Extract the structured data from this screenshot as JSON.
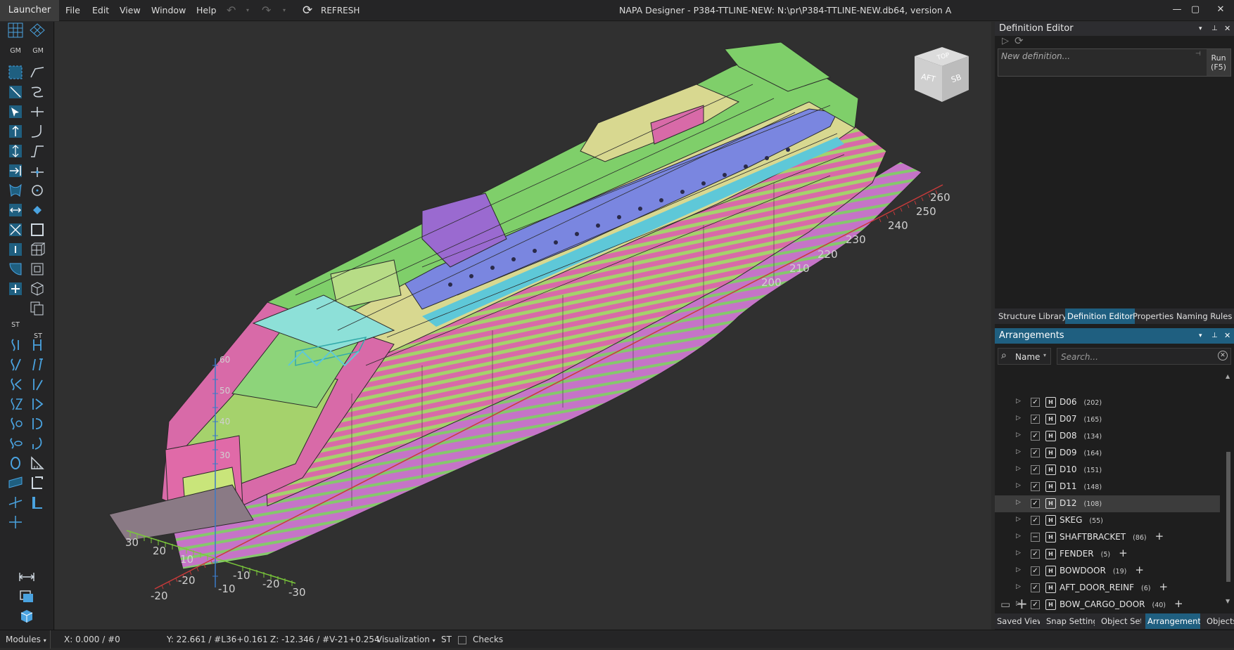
{
  "menubar": {
    "launcher": "Launcher",
    "menus": [
      "File",
      "Edit",
      "View",
      "Window",
      "Help"
    ],
    "refresh": "REFRESH",
    "title": "NAPA Designer - P384-TTLINE-NEW: N:\\pr\\P384-TTLINE-NEW.db64, version A"
  },
  "toolbar": {
    "labels": [
      "GM",
      "GM",
      "ST",
      "ST"
    ]
  },
  "viewport": {
    "navcube": {
      "top": "TOP",
      "aft": "AFT",
      "sb": "SB"
    },
    "x_ticks": [
      "260",
      "250",
      "240",
      "230",
      "220",
      "210",
      "200"
    ],
    "y_ticks": [
      "30",
      "20",
      "10",
      "-10",
      "-20"
    ],
    "z_ticks": [
      "-10",
      "-20",
      "-30"
    ],
    "vertical_ticks": [
      "60",
      "50",
      "40",
      "30"
    ]
  },
  "definition_editor": {
    "title": "Definition Editor",
    "placeholder": "New definition...",
    "run_label": "Run",
    "run_shortcut": "(F5)",
    "tabs": [
      "Structure Library",
      "Definition Editor",
      "Properties",
      "Naming Rules"
    ],
    "selected_tab": "Definition Editor"
  },
  "arrangements": {
    "title": "Arrangements",
    "filter_label": "Name",
    "search_placeholder": "Search...",
    "items": [
      {
        "name": "D06",
        "count": "(202)",
        "check": "✓",
        "plus": ""
      },
      {
        "name": "D07",
        "count": "(165)",
        "check": "✓",
        "plus": ""
      },
      {
        "name": "D08",
        "count": "(134)",
        "check": "✓",
        "plus": ""
      },
      {
        "name": "D09",
        "count": "(164)",
        "check": "✓",
        "plus": ""
      },
      {
        "name": "D10",
        "count": "(151)",
        "check": "✓",
        "plus": ""
      },
      {
        "name": "D11",
        "count": "(148)",
        "check": "✓",
        "plus": ""
      },
      {
        "name": "D12",
        "count": "(108)",
        "check": "✓",
        "plus": ""
      },
      {
        "name": "SKEG",
        "count": "(55)",
        "check": "✓",
        "plus": ""
      },
      {
        "name": "SHAFTBRACKET",
        "count": "(86)",
        "check": "−",
        "plus": "+"
      },
      {
        "name": "FENDER",
        "count": "(5)",
        "check": "✓",
        "plus": "+"
      },
      {
        "name": "BOWDOOR",
        "count": "(19)",
        "check": "✓",
        "plus": "+"
      },
      {
        "name": "AFT_DOOR_REINF",
        "count": "(6)",
        "check": "✓",
        "plus": "+"
      },
      {
        "name": "BOW_CARGO_DOOR",
        "count": "(40)",
        "check": "✓",
        "plus": "+"
      }
    ],
    "selected_item": "D12",
    "bottom_tabs": [
      "Saved Views",
      "Snap Settings",
      "Object Sets",
      "Arrangements",
      "Objects"
    ],
    "selected_bottom_tab": "Arrangements"
  },
  "statusbar": {
    "modules": "Modules",
    "x": "X:  0.000 / #0",
    "y": "Y:  22.661 / #L36+0.161",
    "z": "Z:  -12.346 / #V-21+0.254",
    "visualization": "Visualization",
    "st": "ST",
    "checks": "Checks"
  },
  "colors": {
    "accent": "#1f5f80",
    "deck_green": "#7fcf6a",
    "bulkhead_pink": "#d86aa8",
    "panel_blue": "#7a86e0",
    "cyan": "#5ec8d8",
    "yellow": "#d8d890",
    "purple": "#9a6ad0"
  }
}
